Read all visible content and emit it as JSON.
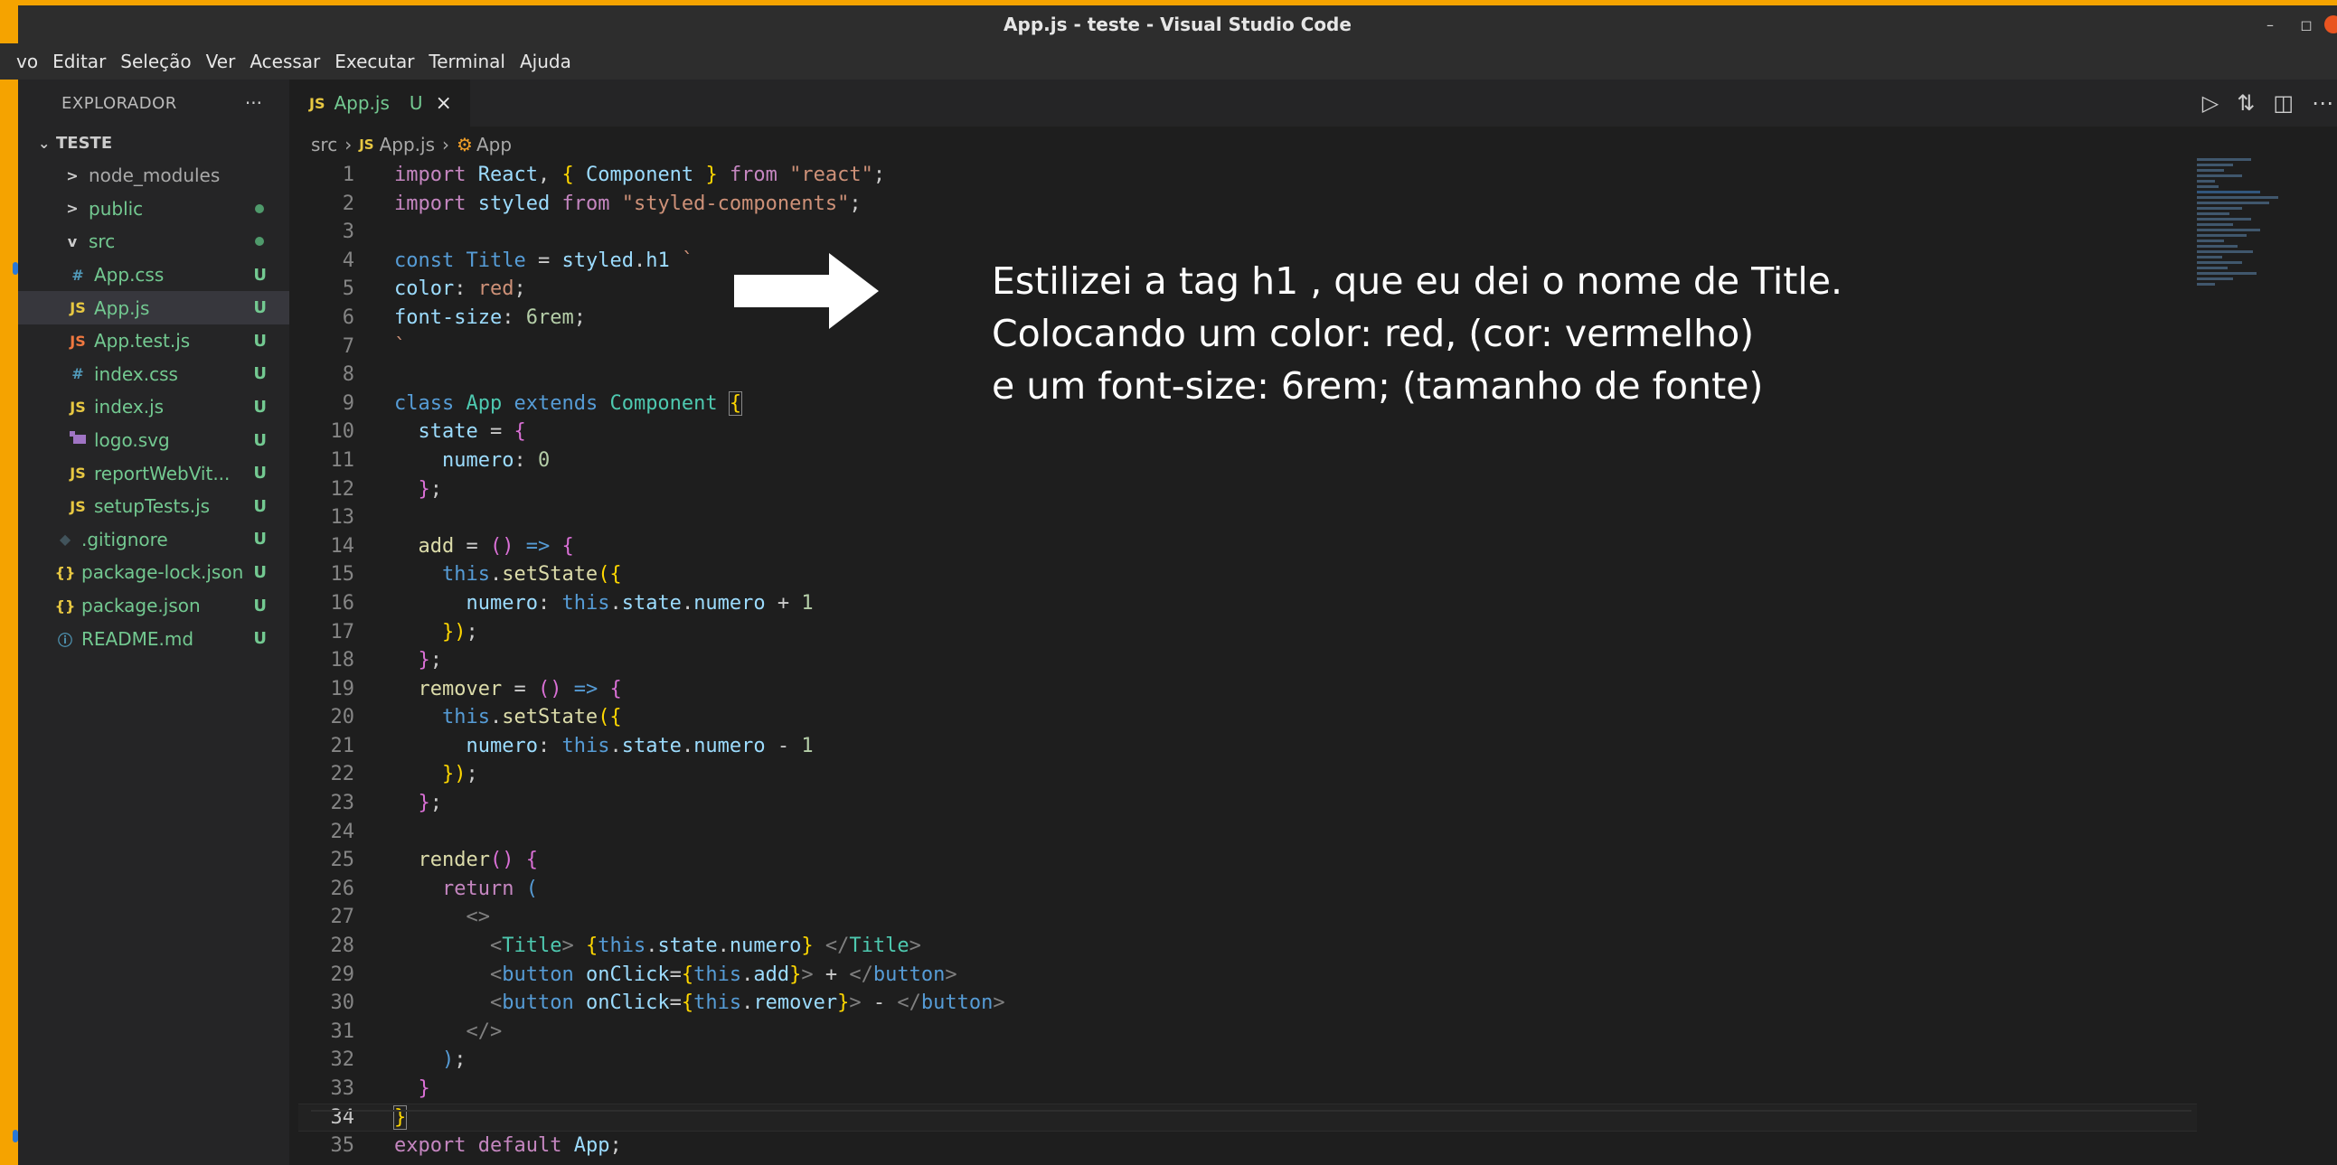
{
  "window": {
    "title": "App.js - teste - Visual Studio Code",
    "controls": [
      "–",
      "◻"
    ]
  },
  "menu": [
    "vo",
    "Editar",
    "Seleção",
    "Ver",
    "Acessar",
    "Executar",
    "Terminal",
    "Ajuda"
  ],
  "sidebar": {
    "title": "EXPLORADOR",
    "more": "···",
    "root": "TESTE",
    "items": [
      {
        "label": "node_modules",
        "icon": ">",
        "badge": ""
      },
      {
        "label": "public",
        "icon": ">",
        "badge": "dot"
      },
      {
        "label": "src",
        "icon": "v",
        "badge": "dot"
      },
      {
        "label": "App.css",
        "icon": "#",
        "badge": "U"
      },
      {
        "label": "App.js",
        "icon": "JS",
        "badge": "U"
      },
      {
        "label": "App.test.js",
        "icon": "JS",
        "badge": "U"
      },
      {
        "label": "index.css",
        "icon": "#",
        "badge": "U"
      },
      {
        "label": "index.js",
        "icon": "JS",
        "badge": "U"
      },
      {
        "label": "logo.svg",
        "icon": "svg",
        "badge": "U"
      },
      {
        "label": "reportWebVit...",
        "icon": "JS",
        "badge": "U"
      },
      {
        "label": "setupTests.js",
        "icon": "JS",
        "badge": "U"
      },
      {
        "label": ".gitignore",
        "icon": "◆",
        "badge": "U"
      },
      {
        "label": "package-lock.json",
        "icon": "{}",
        "badge": "U"
      },
      {
        "label": "package.json",
        "icon": "{}",
        "badge": "U"
      },
      {
        "label": "README.md",
        "icon": "ⓘ",
        "badge": "U"
      }
    ]
  },
  "tab": {
    "badge": "JS",
    "name": "App.js",
    "status": "U",
    "close": "×"
  },
  "breadcrumb": {
    "folder": "src",
    "file": "App.js",
    "symbol": "App"
  },
  "line_numbers": [
    "1",
    "2",
    "3",
    "4",
    "5",
    "6",
    "7",
    "8",
    "9",
    "10",
    "11",
    "12",
    "13",
    "14",
    "15",
    "16",
    "17",
    "18",
    "19",
    "20",
    "21",
    "22",
    "23",
    "24",
    "25",
    "26",
    "27",
    "28",
    "29",
    "30",
    "31",
    "32",
    "33",
    "34",
    "35"
  ],
  "code": {
    "import": "import",
    "from": "from",
    "const": "const",
    "class": "class",
    "extends": "extends",
    "return": "return",
    "export": "export",
    "default": "default",
    "this": "this",
    "react": "React",
    "component": "Component",
    "styled": "styled",
    "title": "Title",
    "h1": "h1",
    "app": "App",
    "react_str": "\"react\"",
    "sc_str": "\"styled-components\"",
    "color_prop": "color",
    "red": "red",
    "font_size_prop": "font-size",
    "six_rem": "6rem",
    "state": "state",
    "numero": "numero",
    "zero": "0",
    "one": "1",
    "add": "add",
    "remover": "remover",
    "set_state": "setState",
    "render": "render",
    "button": "button",
    "on_click": "onClick",
    "plus": "+",
    "minus": "-"
  },
  "annotation": [
    "Estilizei a tag h1 , que eu dei o nome de Title.",
    "Colocando um color: red, (cor: vermelho)",
    "e um font-size: 6rem; (tamanho de fonte)"
  ],
  "colors": {
    "frame": "#f5a300",
    "accent_text": "#73c991"
  }
}
